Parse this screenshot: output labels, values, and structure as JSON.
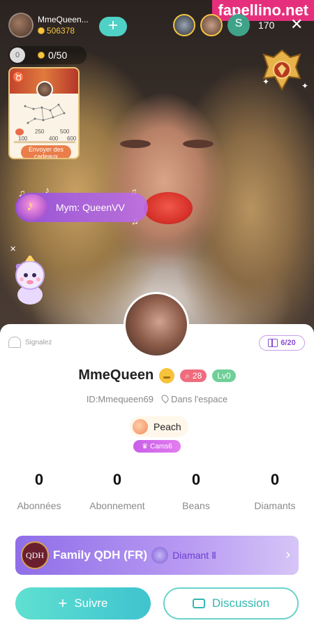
{
  "watermark": "fapellino.net",
  "host": {
    "name": "MmeQueen...",
    "coins": "506378"
  },
  "plus_label": "+",
  "viewers": {
    "s_initial": "S",
    "count": "170"
  },
  "close_label": "✕",
  "wallet": {
    "zero_dot": "0",
    "progress": "0/50"
  },
  "gift_card": {
    "scale_top": [
      "250",
      "500"
    ],
    "scale_bottom": [
      "100",
      "400",
      "600"
    ],
    "button": "Envoyer des cadeaux"
  },
  "music_banner": {
    "text": "Mym: QueenVV"
  },
  "small_close": "✕",
  "profile": {
    "report": "Signalez",
    "gift_count": "6/20",
    "name": "MmeQueen",
    "search_count": "28",
    "level": "Lv0",
    "id": "ID:Mmequeen69",
    "location": "Dans l'espace",
    "tag": "Peach",
    "cams": "Cams6"
  },
  "stats": [
    {
      "value": "0",
      "label": "Abonnées"
    },
    {
      "value": "0",
      "label": "Abonnement"
    },
    {
      "value": "0",
      "label": "Beans"
    },
    {
      "value": "0",
      "label": "Diamants"
    }
  ],
  "family": {
    "logo": "QDH",
    "name": "Family QDH (FR)",
    "tier": "Diamant Ⅱ"
  },
  "buttons": {
    "follow": "Suivre",
    "chat": "Discussion"
  },
  "colors": {
    "accent_teal": "#4fd1c5",
    "purple": "#8f6ee8",
    "pink_badge": "#ef6b7d",
    "green_badge": "#6fcf97",
    "gold": "#f4c542"
  }
}
